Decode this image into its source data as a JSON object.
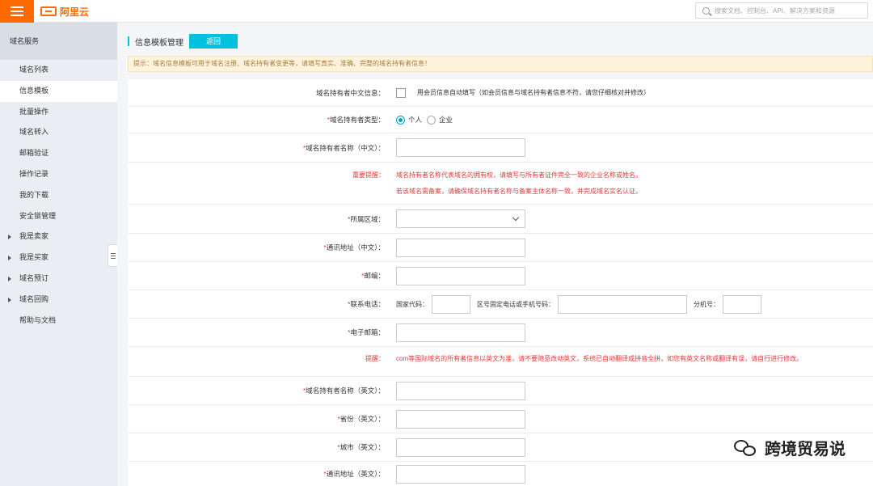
{
  "header": {
    "logo_text": "阿里云",
    "search_placeholder": "搜索文档、控制台、API、解决方案和资源"
  },
  "sidebar": {
    "title": "域名服务",
    "items": [
      {
        "label": "域名列表"
      },
      {
        "label": "信息模板"
      },
      {
        "label": "批量操作"
      },
      {
        "label": "域名转入"
      },
      {
        "label": "邮箱验证"
      },
      {
        "label": "操作记录"
      },
      {
        "label": "我的下载"
      },
      {
        "label": "安全锁管理"
      },
      {
        "label": "我是卖家"
      },
      {
        "label": "我是买家"
      },
      {
        "label": "域名预订"
      },
      {
        "label": "域名回购"
      },
      {
        "label": "帮助与文档"
      }
    ]
  },
  "page": {
    "title": "信息模板管理",
    "back_label": "返回",
    "tip": "提示：域名信息模板可用于域名注册、域名持有者变更等，请填写真实、准确、完整的域名持有者信息！"
  },
  "form": {
    "cn_info_label": "域名持有者中文信息：",
    "cn_info_checkbox": "用会员信息自动填写（如会员信息与域名持有者信息不符，请您仔细核对并修改）",
    "owner_type_label": "域名持有者类型：",
    "owner_type_personal": "个人",
    "owner_type_enterprise": "企业",
    "owner_name_cn_label": "域名持有者名称（中文）：",
    "notice_label": "重要提醒：",
    "notice_line1": "域名持有者名称代表域名的拥有权，请填写与所有者证件完全一致的企业名称或姓名。",
    "notice_line2": "若该域名需备案，请确保域名持有者名称与备案主体名称一致，并完成域名实名认证。",
    "region_label": "所属区域：",
    "address_cn_label": "通讯地址（中文）：",
    "postcode_label": "邮编：",
    "phone_label": "联系电话：",
    "country_code_label": "国家代码：",
    "area_phone_label": "区号固定电话或手机号码：",
    "ext_label": "分机号：",
    "email_label": "电子邮箱：",
    "reminder_label": "提醒：",
    "reminder_text": "com等国际域名的所有者信息以英文为准，请不要随意改动英文，系统已自动翻译成拼音全拼，如您有英文名称或翻译有误，请自行进行修改。",
    "owner_name_en_label": "域名持有者名称（英文）：",
    "province_en_label": "省份（英文）：",
    "city_en_label": "城市（英文）：",
    "address_en_label": "通讯地址（英文）："
  },
  "watermark": {
    "text": "跨境贸易说"
  },
  "colors": {
    "brand": "#ff6a00",
    "accent": "#00c1de",
    "warning_text": "#e03a3a"
  }
}
